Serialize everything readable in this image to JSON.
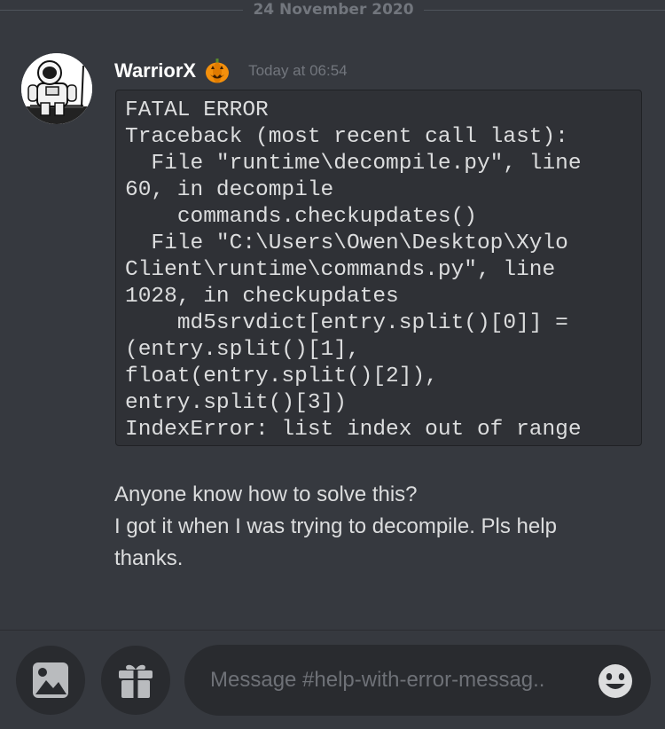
{
  "date_divider": "24 November 2020",
  "message": {
    "author": "WarriorX",
    "author_emoji": "jack-o-lantern",
    "timestamp": "Today at 06:54",
    "code_block": "FATAL ERROR\nTraceback (most recent call last):\n  File \"runtime\\decompile.py\", line\n60, in decompile\n    commands.checkupdates()\n  File \"C:\\Users\\Owen\\Desktop\\Xylo\nClient\\runtime\\commands.py\", line\n1028, in checkupdates\n    md5srvdict[entry.split()[0]] =\n(entry.split()[1],\nfloat(entry.split()[2]),\nentry.split()[3])\nIndexError: list index out of range",
    "text_lines": [
      "Anyone know how to solve this?",
      "I got it when I was trying to decompile. Pls help",
      "thanks."
    ]
  },
  "composer": {
    "placeholder": "Message #help-with-error-messag..",
    "image_button_icon": "image-icon",
    "gift_button_icon": "gift-icon",
    "emoji_button_icon": "emoji-icon"
  },
  "colors": {
    "background": "#36393f",
    "code_background": "#2f3136",
    "composer_background": "#292b2f",
    "text": "#dcddde",
    "muted": "#72767d"
  }
}
